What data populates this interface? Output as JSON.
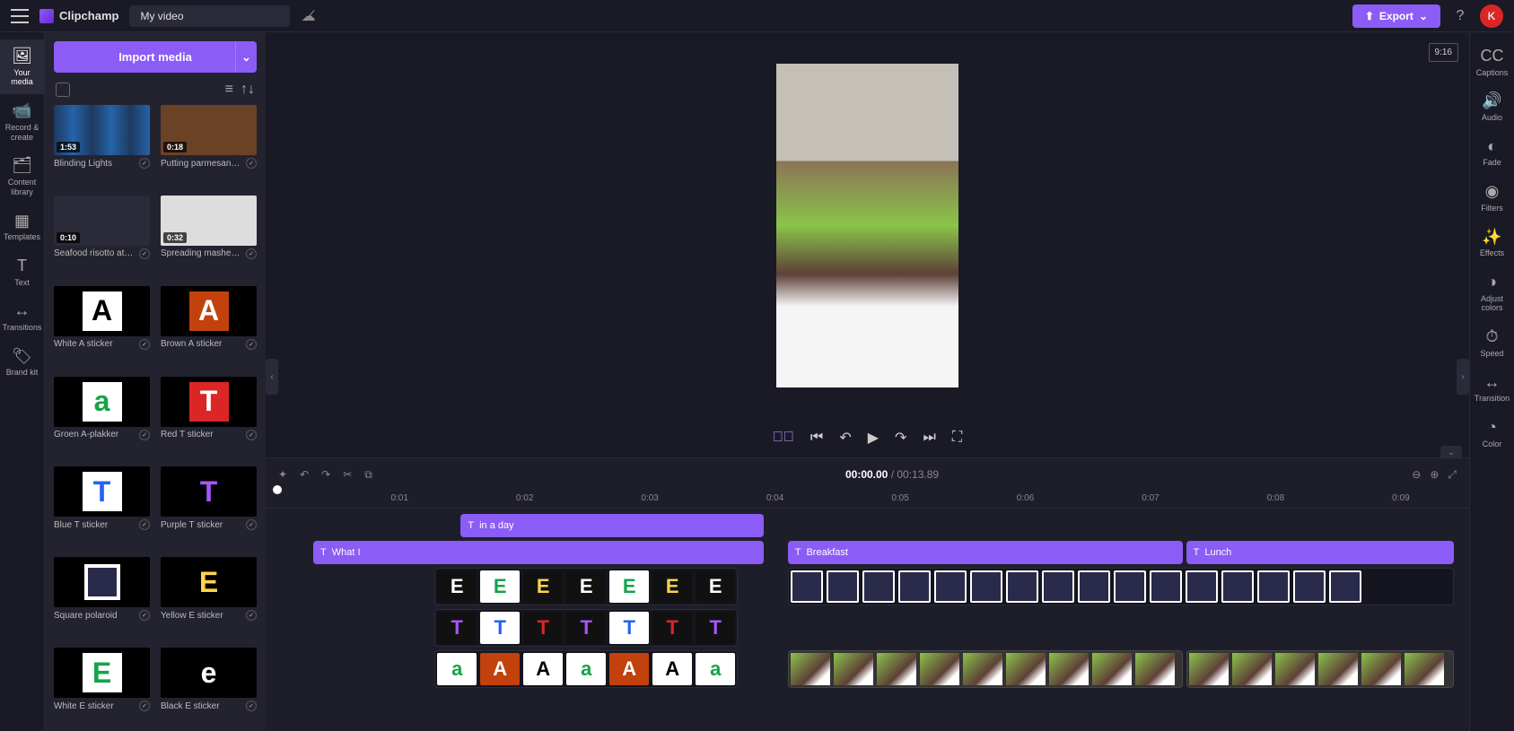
{
  "header": {
    "brand": "Clipchamp",
    "title": "My video",
    "export_label": "Export",
    "avatar_letter": "K"
  },
  "left_rail": [
    {
      "label": "Your media",
      "icon": "🖼"
    },
    {
      "label": "Record & create",
      "icon": "📹"
    },
    {
      "label": "Content library",
      "icon": "🗂"
    },
    {
      "label": "Templates",
      "icon": "▦"
    },
    {
      "label": "Text",
      "icon": "T"
    },
    {
      "label": "Transitions",
      "icon": "↔"
    },
    {
      "label": "Brand kit",
      "icon": "🏷"
    }
  ],
  "media_panel": {
    "import_label": "Import media",
    "items": [
      {
        "name": "Blinding Lights",
        "duration": "1:53",
        "type": "audio",
        "letter": "",
        "bg": "#000",
        "fg": "#fff"
      },
      {
        "name": "Putting parmesan c...",
        "duration": "0:18",
        "type": "video",
        "letter": "",
        "bg": "#6b4226",
        "fg": "#fff"
      },
      {
        "name": "Seafood risotto at r...",
        "duration": "0:10",
        "type": "video",
        "letter": "",
        "bg": "#2a2a38",
        "fg": "#fff"
      },
      {
        "name": "Spreading mashed ...",
        "duration": "0:32",
        "type": "video",
        "letter": "",
        "bg": "#ddd",
        "fg": "#fff"
      },
      {
        "name": "White A sticker",
        "duration": "",
        "type": "sticker",
        "letter": "A",
        "bg": "#fff",
        "fg": "#000"
      },
      {
        "name": "Brown A sticker",
        "duration": "",
        "type": "sticker",
        "letter": "A",
        "bg": "#c2410c",
        "fg": "#fff"
      },
      {
        "name": "Groen A-plakker",
        "duration": "",
        "type": "sticker",
        "letter": "a",
        "bg": "#fff",
        "fg": "#16a34a"
      },
      {
        "name": "Red T sticker",
        "duration": "",
        "type": "sticker",
        "letter": "T",
        "bg": "#dc2626",
        "fg": "#fff"
      },
      {
        "name": "Blue T sticker",
        "duration": "",
        "type": "sticker",
        "letter": "T",
        "bg": "#fff",
        "fg": "#2563eb"
      },
      {
        "name": "Purple T sticker",
        "duration": "",
        "type": "sticker",
        "letter": "T",
        "bg": "#000",
        "fg": "#a855f7"
      },
      {
        "name": "Square polaroid",
        "duration": "",
        "type": "sticker",
        "letter": "",
        "bg": "#2a2a4a",
        "fg": "#fff",
        "border": "#fff"
      },
      {
        "name": "Yellow E sticker",
        "duration": "",
        "type": "sticker",
        "letter": "E",
        "bg": "#000",
        "fg": "#fcd34d"
      },
      {
        "name": "White E sticker",
        "duration": "",
        "type": "sticker",
        "letter": "E",
        "bg": "#fff",
        "fg": "#16a34a"
      },
      {
        "name": "Black E sticker",
        "duration": "",
        "type": "sticker",
        "letter": "e",
        "bg": "#000",
        "fg": "#fff"
      }
    ]
  },
  "preview": {
    "aspect_label": "9:16"
  },
  "timeline": {
    "current_time": "00:00.00",
    "total_time": "00:13.89",
    "ticks": [
      "0:01",
      "0:02",
      "0:03",
      "0:04",
      "0:05",
      "0:06",
      "0:07",
      "0:08",
      "0:09"
    ],
    "text_clips": [
      {
        "label": "in a day",
        "left_pct": 15.8,
        "width_pct": 25.5
      },
      {
        "label": "What I",
        "left_pct": 3.4,
        "width_pct": 37.9
      },
      {
        "label": "Breakfast",
        "left_pct": 43.3,
        "width_pct": 33.2
      },
      {
        "label": "Lunch",
        "left_pct": 76.8,
        "width_pct": 22.5
      }
    ],
    "sticker_rows": [
      {
        "left_pct": 13.6,
        "letters": [
          {
            "t": "E",
            "bg": "#111",
            "fg": "#fff"
          },
          {
            "t": "E",
            "bg": "#fff",
            "fg": "#16a34a"
          },
          {
            "t": "E",
            "bg": "#111",
            "fg": "#fcd34d"
          },
          {
            "t": "E",
            "bg": "#111",
            "fg": "#fff"
          },
          {
            "t": "E",
            "bg": "#fff",
            "fg": "#16a34a"
          },
          {
            "t": "E",
            "bg": "#111",
            "fg": "#fcd34d"
          },
          {
            "t": "E",
            "bg": "#111",
            "fg": "#fff"
          }
        ]
      },
      {
        "left_pct": 13.6,
        "letters": [
          {
            "t": "T",
            "bg": "#111",
            "fg": "#a855f7"
          },
          {
            "t": "T",
            "bg": "#fff",
            "fg": "#2563eb"
          },
          {
            "t": "T",
            "bg": "#111",
            "fg": "#dc2626"
          },
          {
            "t": "T",
            "bg": "#111",
            "fg": "#a855f7"
          },
          {
            "t": "T",
            "bg": "#fff",
            "fg": "#2563eb"
          },
          {
            "t": "T",
            "bg": "#111",
            "fg": "#dc2626"
          },
          {
            "t": "T",
            "bg": "#111",
            "fg": "#a855f7"
          }
        ]
      },
      {
        "left_pct": 13.6,
        "letters": [
          {
            "t": "a",
            "bg": "#fff",
            "fg": "#16a34a"
          },
          {
            "t": "A",
            "bg": "#c2410c",
            "fg": "#fff"
          },
          {
            "t": "A",
            "bg": "#fff",
            "fg": "#000"
          },
          {
            "t": "a",
            "bg": "#fff",
            "fg": "#16a34a"
          },
          {
            "t": "A",
            "bg": "#c2410c",
            "fg": "#fff"
          },
          {
            "t": "A",
            "bg": "#fff",
            "fg": "#000"
          },
          {
            "t": "a",
            "bg": "#fff",
            "fg": "#16a34a"
          }
        ]
      }
    ],
    "polaroid_strip": {
      "left_pct": 43.3,
      "width_pct": 56,
      "count": 16
    },
    "video_strips": [
      {
        "left_pct": 43.3,
        "width_pct": 33.2
      },
      {
        "left_pct": 76.8,
        "width_pct": 22.5
      }
    ]
  },
  "right_rail": [
    {
      "label": "Captions",
      "icon": "CC"
    },
    {
      "label": "Audio",
      "icon": "🔊"
    },
    {
      "label": "Fade",
      "icon": "◐"
    },
    {
      "label": "Filters",
      "icon": "◉"
    },
    {
      "label": "Effects",
      "icon": "✨"
    },
    {
      "label": "Adjust colors",
      "icon": "◑"
    },
    {
      "label": "Speed",
      "icon": "⏱"
    },
    {
      "label": "Transition",
      "icon": "↔"
    },
    {
      "label": "Color",
      "icon": "◔"
    }
  ]
}
